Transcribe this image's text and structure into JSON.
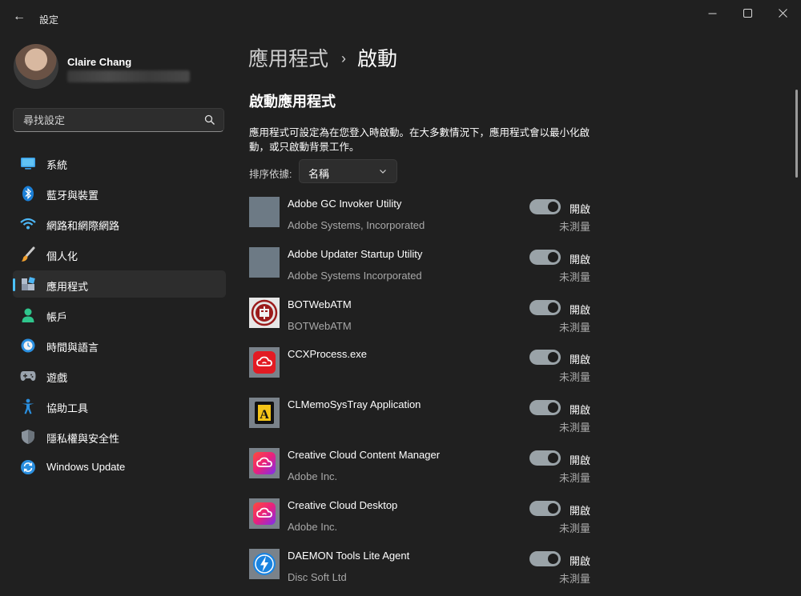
{
  "window": {
    "title": "設定",
    "back_glyph": "←",
    "minimize_glyph": "—",
    "close_glyph": "✕"
  },
  "profile": {
    "name": "Claire Chang"
  },
  "search": {
    "placeholder": "尋找設定"
  },
  "sidebar": {
    "items": [
      {
        "label": "系統",
        "icon": "monitor-icon"
      },
      {
        "label": "藍牙與裝置",
        "icon": "bluetooth-icon"
      },
      {
        "label": "網路和網際網路",
        "icon": "wifi-icon"
      },
      {
        "label": "個人化",
        "icon": "brush-icon"
      },
      {
        "label": "應用程式",
        "icon": "apps-icon",
        "selected": true
      },
      {
        "label": "帳戶",
        "icon": "person-icon"
      },
      {
        "label": "時間與語言",
        "icon": "clock-globe-icon"
      },
      {
        "label": "遊戲",
        "icon": "gamepad-icon"
      },
      {
        "label": "協助工具",
        "icon": "accessibility-icon"
      },
      {
        "label": "隱私權與安全性",
        "icon": "shield-icon"
      },
      {
        "label": "Windows Update",
        "icon": "update-icon"
      }
    ]
  },
  "breadcrumb": {
    "parent": "應用程式",
    "separator": "›",
    "current": "啟動"
  },
  "main": {
    "section_title": "啟動應用程式",
    "description": "應用程式可設定為在您登入時啟動。在大多數情況下，應用程式會以最小化啟動，或只啟動背景工作。",
    "sort_label": "排序依據:",
    "sort_value": "名稱"
  },
  "apps": [
    {
      "name": "Adobe GC Invoker Utility",
      "publisher": "Adobe Systems, Incorporated",
      "state": "開啟",
      "impact": "未測量",
      "icon": "placeholder-icon"
    },
    {
      "name": "Adobe Updater Startup Utility",
      "publisher": "Adobe Systems Incorporated",
      "state": "開啟",
      "impact": "未測量",
      "icon": "placeholder-icon"
    },
    {
      "name": "BOTWebATM",
      "publisher": "BOTWebATM",
      "state": "開啟",
      "impact": "未測量",
      "icon": "botwebatm-icon"
    },
    {
      "name": "CCXProcess.exe",
      "publisher": "",
      "state": "開啟",
      "impact": "未測量",
      "icon": "creative-cloud-red-icon"
    },
    {
      "name": "CLMemoSysTray Application",
      "publisher": "",
      "state": "開啟",
      "impact": "未測量",
      "icon": "clmemo-icon"
    },
    {
      "name": "Creative Cloud Content Manager",
      "publisher": "Adobe Inc.",
      "state": "開啟",
      "impact": "未測量",
      "icon": "creative-cloud-icon"
    },
    {
      "name": "Creative Cloud Desktop",
      "publisher": "Adobe Inc.",
      "state": "開啟",
      "impact": "未測量",
      "icon": "creative-cloud-icon"
    },
    {
      "name": "DAEMON Tools Lite Agent",
      "publisher": "Disc Soft Ltd",
      "state": "開啟",
      "impact": "未測量",
      "icon": "daemon-tools-icon"
    }
  ]
}
